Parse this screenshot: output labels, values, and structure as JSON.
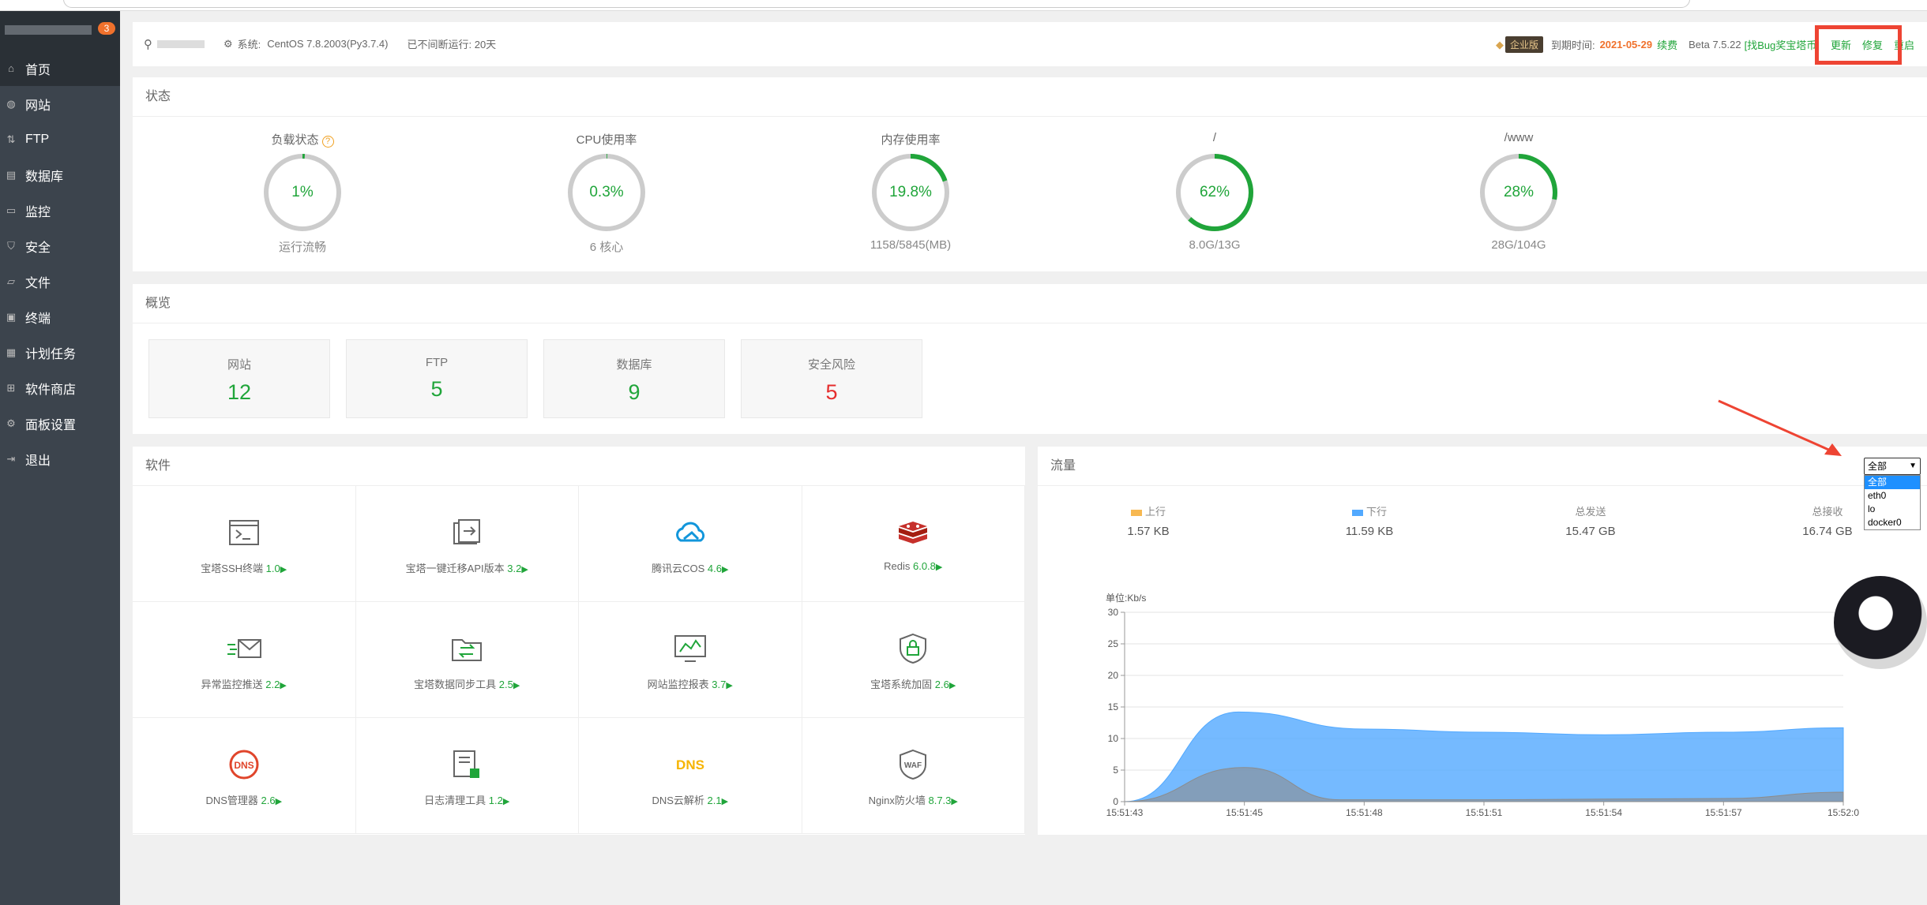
{
  "sidebar": {
    "badge": "3",
    "items": [
      {
        "label": "首页",
        "icon": "home-icon"
      },
      {
        "label": "网站",
        "icon": "globe-icon"
      },
      {
        "label": "FTP",
        "icon": "ftp-icon"
      },
      {
        "label": "数据库",
        "icon": "database-icon"
      },
      {
        "label": "监控",
        "icon": "monitor-icon"
      },
      {
        "label": "安全",
        "icon": "shield-icon"
      },
      {
        "label": "文件",
        "icon": "folder-icon"
      },
      {
        "label": "终端",
        "icon": "terminal-icon"
      },
      {
        "label": "计划任务",
        "icon": "calendar-icon"
      },
      {
        "label": "软件商店",
        "icon": "grid-icon"
      },
      {
        "label": "面板设置",
        "icon": "settings-icon"
      },
      {
        "label": "退出",
        "icon": "logout-icon"
      }
    ]
  },
  "topbar": {
    "system_label": "系统:",
    "system_value": "CentOS 7.8.2003(Py3.7.4)",
    "uptime": "已不间断运行: 20天",
    "edition": "企业版",
    "expire_label": "到期时间:",
    "expire_date": "2021-05-29",
    "renew": "续费",
    "version": "Beta 7.5.22",
    "bug_link": "[找Bug奖宝塔币]",
    "update": "更新",
    "repair": "修复",
    "restart": "重启"
  },
  "status": {
    "title": "状态",
    "gauges": [
      {
        "title": "负载状态",
        "value_text": "1%",
        "value": 1,
        "bottom": "运行流畅",
        "help": "?"
      },
      {
        "title": "CPU使用率",
        "value_text": "0.3%",
        "value": 0.3,
        "bottom": "6 核心"
      },
      {
        "title": "内存使用率",
        "value_text": "19.8%",
        "value": 19.8,
        "bottom": "1158/5845(MB)"
      },
      {
        "title": "/",
        "value_text": "62%",
        "value": 62,
        "bottom": "8.0G/13G"
      },
      {
        "title": "/www",
        "value_text": "28%",
        "value": 28,
        "bottom": "28G/104G"
      }
    ]
  },
  "overview": {
    "title": "概览",
    "cards": [
      {
        "label": "网站",
        "value": "12"
      },
      {
        "label": "FTP",
        "value": "5"
      },
      {
        "label": "数据库",
        "value": "9"
      },
      {
        "label": "安全风险",
        "value": "5"
      }
    ]
  },
  "software": {
    "title": "软件",
    "items": [
      {
        "name": "宝塔SSH终端",
        "version": "1.0",
        "icon": "ssh-terminal-icon"
      },
      {
        "name": "宝塔一键迁移API版本",
        "version": "3.2",
        "icon": "migrate-icon"
      },
      {
        "name": "腾讯云COS",
        "version": "4.6",
        "icon": "cloud-icon"
      },
      {
        "name": "Redis",
        "version": "6.0.8",
        "icon": "redis-icon"
      },
      {
        "name": "异常监控推送",
        "version": "2.2",
        "icon": "mail-push-icon"
      },
      {
        "name": "宝塔数据同步工具",
        "version": "2.5",
        "icon": "sync-folder-icon"
      },
      {
        "name": "网站监控报表",
        "version": "3.7",
        "icon": "monitor-chart-icon"
      },
      {
        "name": "宝塔系统加固",
        "version": "2.6",
        "icon": "lock-shield-icon"
      },
      {
        "name": "DNS管理器",
        "version": "2.6",
        "icon": "dns-manager-icon"
      },
      {
        "name": "日志清理工具",
        "version": "1.2",
        "icon": "log-clean-icon"
      },
      {
        "name": "DNS云解析",
        "version": "2.1",
        "icon": "dns-cloud-icon"
      },
      {
        "name": "Nginx防火墙",
        "version": "8.7.3",
        "icon": "waf-icon"
      }
    ]
  },
  "traffic": {
    "title": "流量",
    "select": {
      "selected": "全部",
      "options": [
        "全部",
        "eth0",
        "lo",
        "docker0"
      ]
    },
    "stats": [
      {
        "label": "上行",
        "value": "1.57 KB",
        "color": "#f7b851"
      },
      {
        "label": "下行",
        "value": "11.59 KB",
        "color": "#52a9ff"
      },
      {
        "label": "总发送",
        "value": "15.47 GB"
      },
      {
        "label": "总接收",
        "value": "16.74 GB"
      }
    ]
  },
  "chart_data": {
    "type": "area",
    "ylabel": "单位:Kb/s",
    "ylim": [
      0,
      30
    ],
    "yticks": [
      0,
      5,
      10,
      15,
      20,
      25,
      30
    ],
    "x_labels": [
      "15:51:43",
      "15:51:45",
      "15:51:48",
      "15:51:51",
      "15:51:54",
      "15:51:57",
      "15:52:0"
    ],
    "series": [
      {
        "name": "下行",
        "color": "#52a9ff",
        "x": [
          0,
          0.95,
          2,
          3,
          4,
          5,
          6
        ],
        "values": [
          0,
          14.2,
          11.5,
          11,
          10.6,
          11,
          11.7
        ]
      },
      {
        "name": "上行",
        "color": "#8c8c8c",
        "x": [
          0,
          1,
          1.8,
          3,
          4,
          5,
          6
        ],
        "values": [
          0,
          5.4,
          0.3,
          0.3,
          0.4,
          0.5,
          1.5
        ]
      }
    ]
  },
  "colors": {
    "accent": "#20a53a",
    "danger": "#e52d2d",
    "sidebar": "#3c444d"
  }
}
